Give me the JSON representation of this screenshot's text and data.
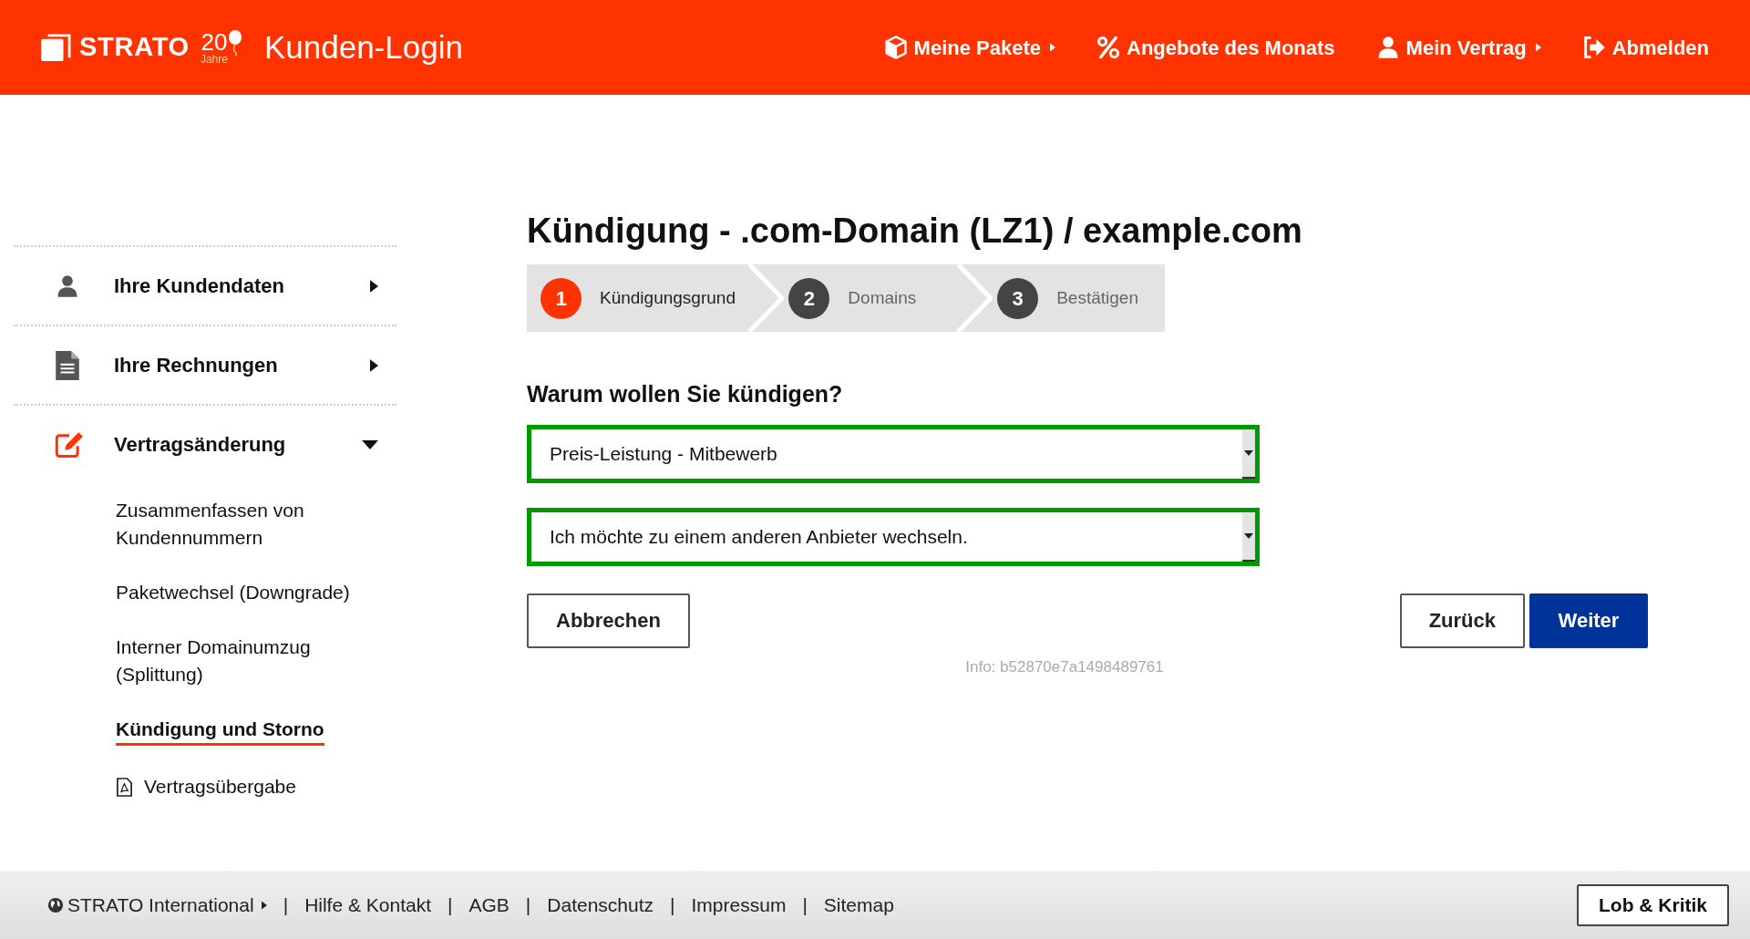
{
  "header": {
    "brand": "STRATO",
    "anniversary": "20",
    "anniversary_label": "Jahre",
    "title": "Kunden-Login",
    "nav": [
      {
        "label": "Meine Pakete",
        "has_menu": true
      },
      {
        "label": "Angebote des Monats",
        "has_menu": false
      },
      {
        "label": "Mein Vertrag",
        "has_menu": true
      },
      {
        "label": "Abmelden",
        "has_menu": false
      }
    ]
  },
  "sidebar": {
    "items": [
      {
        "label": "Ihre Kundendaten",
        "expanded": false
      },
      {
        "label": "Ihre Rechnungen",
        "expanded": false
      },
      {
        "label": "Vertragsänderung",
        "expanded": true,
        "children": [
          {
            "label": "Zusammenfassen von Kundennummern",
            "selected": false,
            "kind": "link"
          },
          {
            "label": "Paketwechsel (Downgrade)",
            "selected": false,
            "kind": "link"
          },
          {
            "label": "Interner Domainumzug (Splittung)",
            "selected": false,
            "kind": "link"
          },
          {
            "label": "Kündigung und Storno",
            "selected": true,
            "kind": "link"
          },
          {
            "label": "Vertragsübergabe",
            "selected": false,
            "kind": "pdf"
          }
        ]
      }
    ]
  },
  "page": {
    "title": "Kündigung - .com-Domain (LZ1) / example.com",
    "steps": [
      {
        "number": "1",
        "label": "Kündigungsgrund",
        "selected": true
      },
      {
        "number": "2",
        "label": "Domains",
        "selected": false
      },
      {
        "number": "3",
        "label": "Bestätigen",
        "selected": false
      }
    ],
    "question": "Warum wollen Sie kündigen?",
    "selects": [
      {
        "value": "Preis-Leistung - Mitbewerb"
      },
      {
        "value": "Ich möchte zu einem anderen Anbieter wechseln."
      }
    ],
    "buttons": [
      {
        "label": "Abbrechen",
        "kind": "secondary"
      },
      {
        "label": "Zurück",
        "kind": "secondary"
      },
      {
        "label": "Weiter",
        "kind": "primary"
      }
    ],
    "info": "Info: b52870e7a1498489761"
  },
  "footer": {
    "links": [
      {
        "label": "STRATO International",
        "has_menu": true
      },
      {
        "label": "Hilfe & Kontakt",
        "has_menu": false
      },
      {
        "label": "AGB",
        "has_menu": false
      },
      {
        "label": "Datenschutz",
        "has_menu": false
      },
      {
        "label": "Impressum",
        "has_menu": false
      },
      {
        "label": "Sitemap",
        "has_menu": false
      }
    ],
    "separator": "|",
    "feedback": "Lob & Kritik"
  }
}
